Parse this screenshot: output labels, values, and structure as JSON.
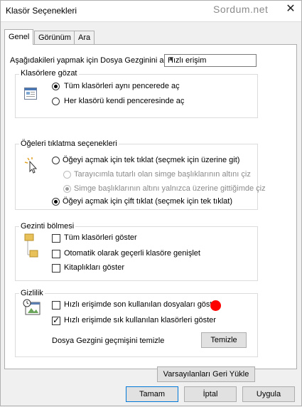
{
  "window": {
    "title": "Klasör Seçenekleri",
    "watermark": "Sordum.net",
    "close_icon": "close-icon"
  },
  "tabs": [
    {
      "label": "Genel",
      "active": true
    },
    {
      "label": "Görünüm",
      "active": false
    },
    {
      "label": "Ara",
      "active": false
    }
  ],
  "open_explorer": {
    "label": "Aşağıdakileri yapmak için Dosya Gezginini aç:",
    "selected": "Hızlı erişim"
  },
  "browse_folders": {
    "title": "Klasörlere gözat",
    "icon": "window-icon",
    "options": [
      {
        "label": "Tüm klasörleri aynı pencerede aç",
        "checked": true
      },
      {
        "label": "Her klasörü kendi penceresinde aç",
        "checked": false
      }
    ]
  },
  "click_items": {
    "title": "Öğeleri tıklatma seçenekleri",
    "icon": "pointer-icon",
    "single_click": {
      "label": "Öğeyi açmak için tek tıklat (seçmek için üzerine git)",
      "checked": false
    },
    "sub_options": [
      {
        "label": "Tarayıcımla tutarlı olan simge başlıklarının altını çiz",
        "checked": false
      },
      {
        "label": "Simge başlıklarının altını yalnızca üzerine gittiğimde çiz",
        "checked": true
      }
    ],
    "double_click": {
      "label": "Öğeyi açmak için çift tıklat (seçmek için tek tıklat)",
      "checked": true
    }
  },
  "nav_pane": {
    "title": "Gezinti bölmesi",
    "icon": "folder-tree-icon",
    "options": [
      {
        "label": "Tüm klasörleri göster",
        "checked": false
      },
      {
        "label": "Otomatik olarak geçerli klasöre genişlet",
        "checked": false
      },
      {
        "label": "Kitaplıkları göster",
        "checked": false
      }
    ]
  },
  "privacy": {
    "title": "Gizlilik",
    "icon": "privacy-icon",
    "options": [
      {
        "label": "Hızlı erişimde son kullanılan dosyaları göster",
        "checked": false
      },
      {
        "label": "Hızlı erişimde sık kullanılan klasörleri göster",
        "checked": true
      }
    ],
    "clear_label": "Dosya Gezgini geçmişini temizle",
    "clear_button": "Temizle",
    "marker_color": "#ff0000"
  },
  "restore_defaults": "Varsayılanları Geri Yükle",
  "footer": {
    "ok": "Tamam",
    "cancel": "İptal",
    "apply": "Uygula"
  }
}
